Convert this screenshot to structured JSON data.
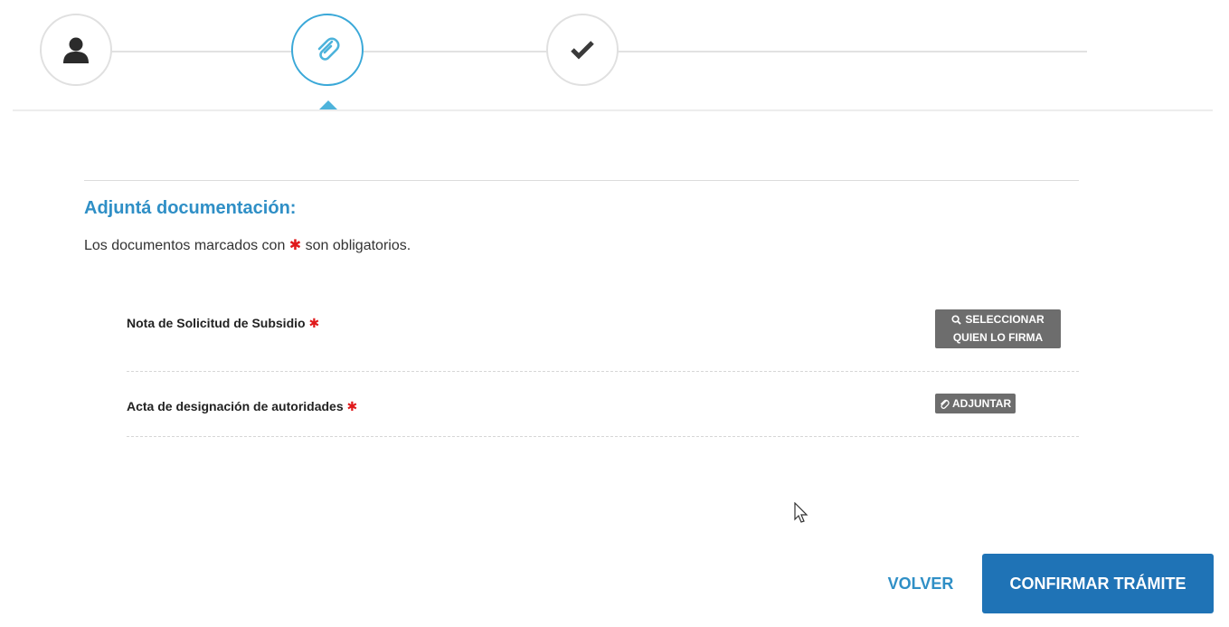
{
  "stepper": {
    "steps": [
      {
        "icon": "user-icon",
        "state": "completed"
      },
      {
        "icon": "paperclip-icon",
        "state": "active"
      },
      {
        "icon": "checkmark-icon",
        "state": "pending"
      }
    ],
    "accent_color": "#3aa8d8"
  },
  "section": {
    "title": "Adjuntá documentación:",
    "subtitle_before": "Los documentos marcados con",
    "required_marker": "✱",
    "subtitle_after": "son obligatorios."
  },
  "documents": [
    {
      "label": "Nota de Solicitud de Subsidio",
      "action_line1": "SELECCIONAR",
      "action_line2": "QUIEN LO FIRMA",
      "action_icon": "search-icon"
    },
    {
      "label": "Acta de designación de autoridades",
      "action": "ADJUNTAR",
      "action_icon": "paperclip-icon"
    }
  ],
  "footer": {
    "back_label": "VOLVER",
    "confirm_label": "CONFIRMAR TRÁMITE"
  },
  "colors": {
    "primary": "#1f73b6",
    "title": "#2f8fc6",
    "required": "#e0191b",
    "action_button": "#6d6d6d"
  }
}
